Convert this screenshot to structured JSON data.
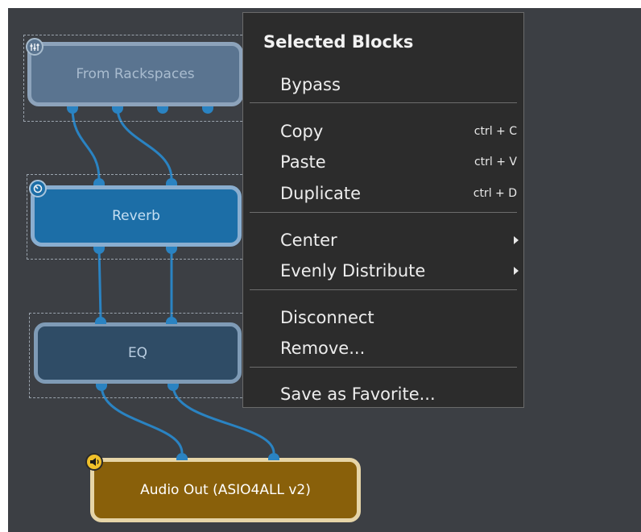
{
  "blocks": {
    "from_rackspaces": {
      "label": "From Rackspaces",
      "icon": "mixer-sliders-icon",
      "selected": true
    },
    "reverb": {
      "label": "Reverb",
      "icon": "knob-icon",
      "selected": true
    },
    "eq": {
      "label": "EQ",
      "selected": true
    },
    "audio_out": {
      "label": "Audio Out (ASIO4ALL v2)",
      "icon": "speaker-icon",
      "selected": false
    }
  },
  "context_menu": {
    "header": "Selected Blocks",
    "items": [
      {
        "label": "Bypass"
      },
      {
        "label": "Copy",
        "shortcut": "ctrl + C"
      },
      {
        "label": "Paste",
        "shortcut": "ctrl + V"
      },
      {
        "label": "Duplicate",
        "shortcut": "ctrl + D"
      },
      {
        "label": "Center",
        "submenu": true
      },
      {
        "label": "Evenly Distribute",
        "submenu": true
      },
      {
        "label": "Disconnect"
      },
      {
        "label": "Remove..."
      },
      {
        "label": "Save as Favorite..."
      }
    ]
  },
  "colors": {
    "canvas_bg": "#3c3f44",
    "wire": "#2a83c2",
    "reverb_block": "#1c6ea7",
    "audio_out_block": "#89600a",
    "menu_bg": "#2c2c2c"
  }
}
